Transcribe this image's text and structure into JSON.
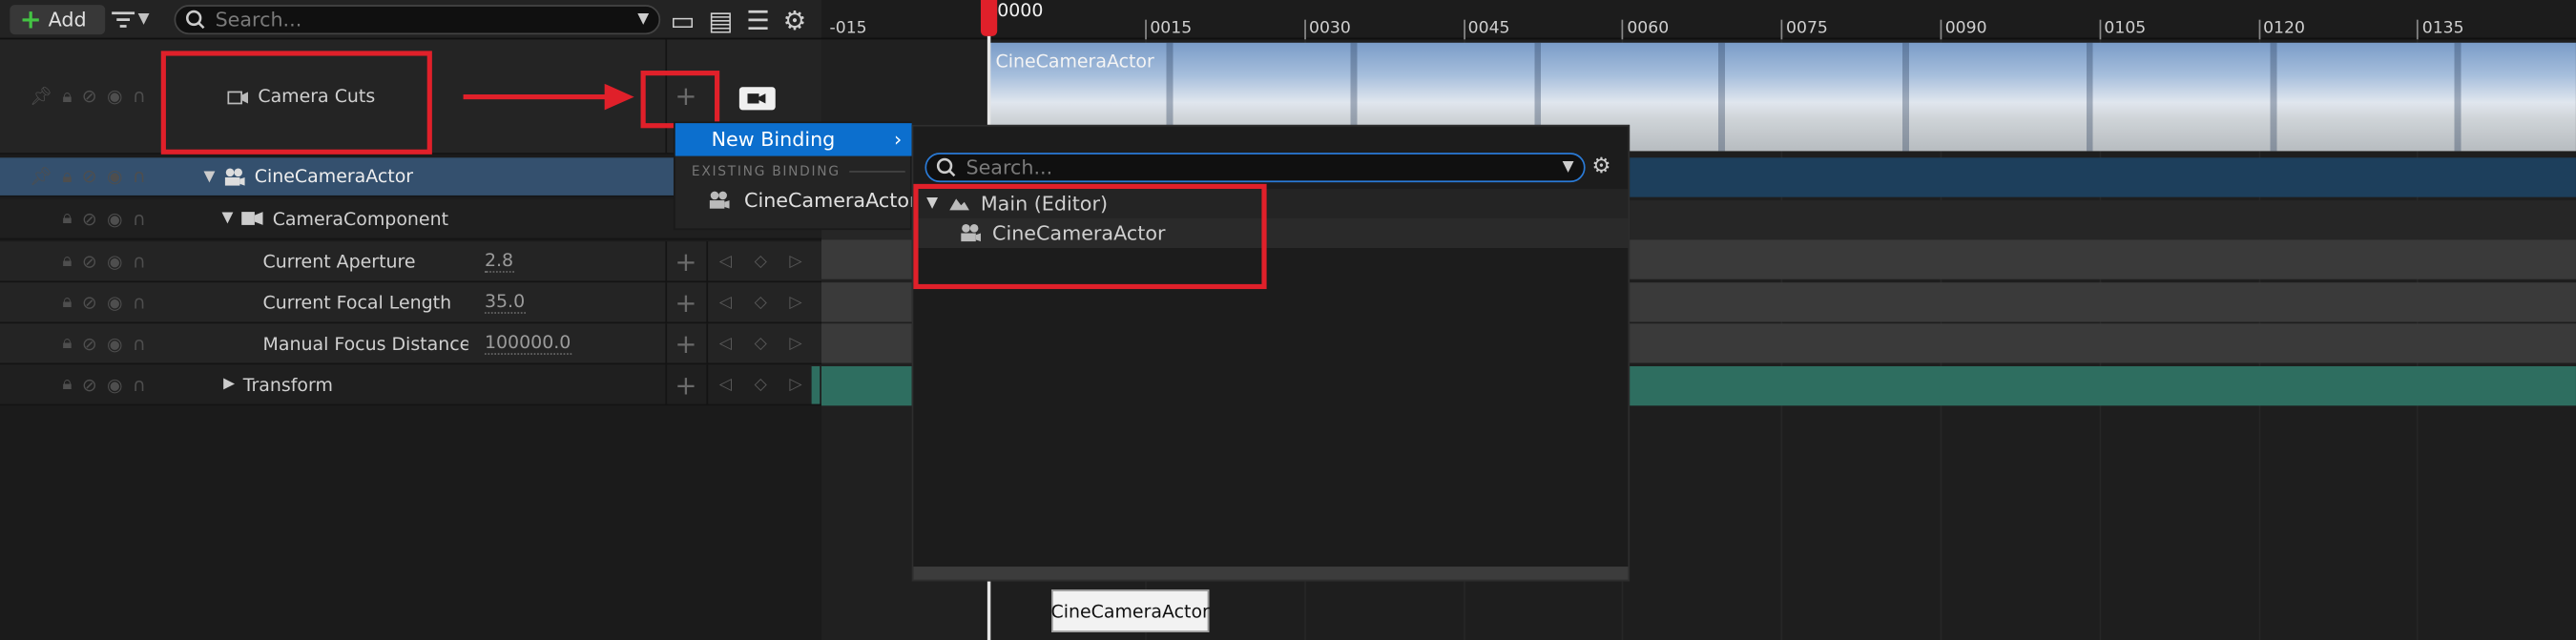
{
  "toolbar": {
    "add_label": "Add",
    "search_placeholder": "Search..."
  },
  "outliner": {
    "camera_cuts": "Camera Cuts",
    "actor": "CineCameraActor",
    "component": "CameraComponent",
    "props": [
      {
        "label": "Current Aperture",
        "value": "2.8"
      },
      {
        "label": "Current Focal Length",
        "value": "35.0"
      },
      {
        "label": "Manual Focus Distance (Fc",
        "value": "100000.0"
      }
    ],
    "transform": "Transform"
  },
  "timeline": {
    "current_frame": "0000",
    "left_tick": "-015",
    "ticks": [
      "0015",
      "0030",
      "0045",
      "0060",
      "0075",
      "0090",
      "0105",
      "0120",
      "0135"
    ],
    "clip_label": "CineCameraActor"
  },
  "binding_menu": {
    "new_binding": "New Binding",
    "existing_header": "EXISTING BINDING",
    "existing_item": "CineCameraActor"
  },
  "actor_picker": {
    "search_placeholder": "Search...",
    "group": "Main (Editor)",
    "item": "CineCameraActor"
  },
  "tooltip": "CineCameraActor",
  "colors": {
    "highlight": "#0c6fce",
    "annotation": "#e0202a",
    "actor_row": "#34506e"
  }
}
